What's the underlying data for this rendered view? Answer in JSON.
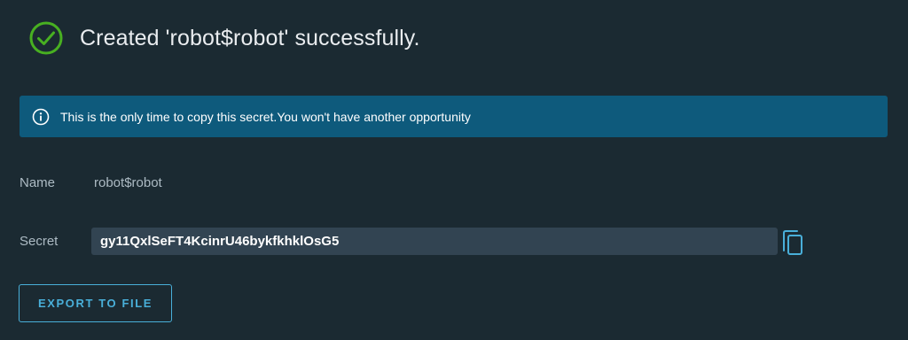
{
  "header": {
    "title": "Created 'robot$robot' successfully.",
    "icon": "check-circle-icon",
    "icon_color": "#48b021"
  },
  "alert": {
    "icon": "info-icon",
    "text": "This is the only time to copy this secret.You won't have another opportunity",
    "background": "#0e5a7c"
  },
  "fields": {
    "name_label": "Name",
    "name_value": "robot$robot",
    "secret_label": "Secret",
    "secret_value": "gy11QxlSeFT4KcinrU46bykfkhklOsG5",
    "copy_icon": "copy-icon"
  },
  "actions": {
    "export_label": "EXPORT TO FILE",
    "accent": "#49afd9"
  }
}
